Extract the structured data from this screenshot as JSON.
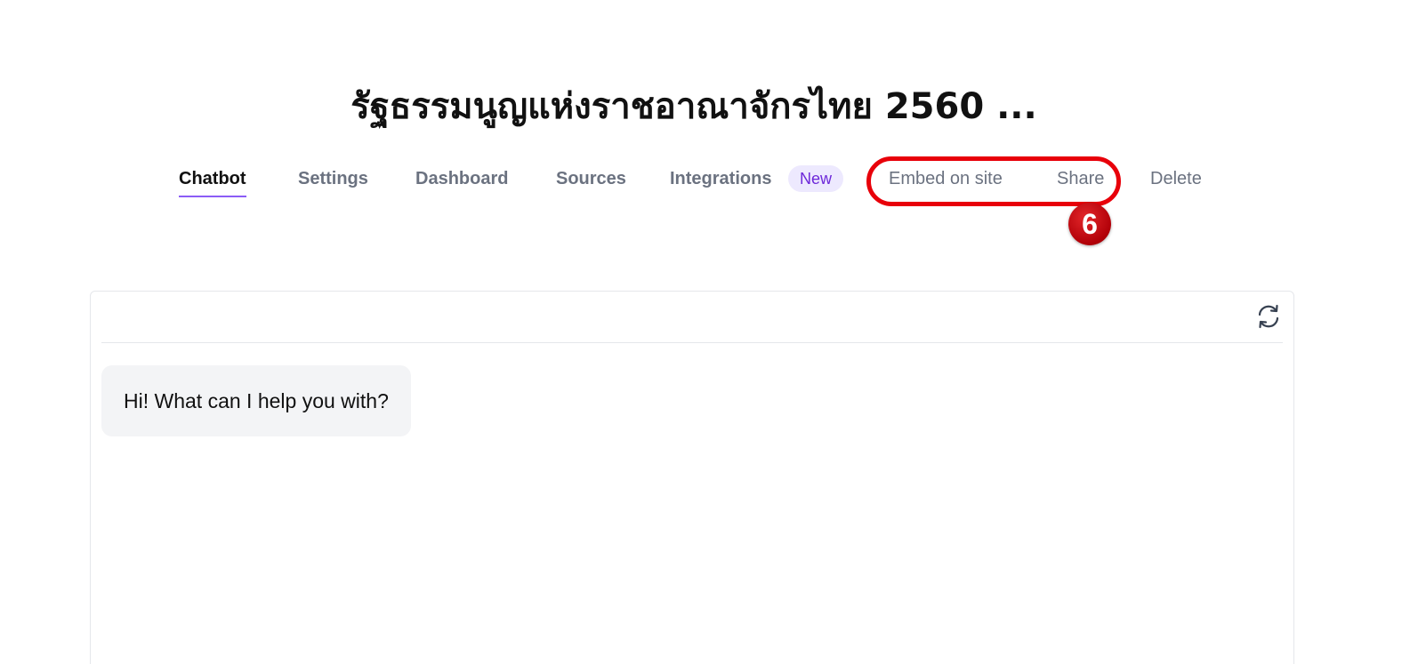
{
  "page_title": "รัฐธรรมนูญแห่งราชอาณาจักรไทย 2560 ...",
  "tabs": {
    "chatbot": "Chatbot",
    "settings": "Settings",
    "dashboard": "Dashboard",
    "sources": "Sources",
    "integrations": "Integrations",
    "integrations_badge": "New",
    "embed": "Embed on site",
    "share": "Share",
    "delete": "Delete"
  },
  "annotation": {
    "step_number": "6",
    "color": "#e8000a"
  },
  "chat": {
    "greeting": "Hi! What can I help you with?",
    "refresh_icon": "refresh-icon"
  },
  "colors": {
    "accent": "#8b5cf6",
    "badge_bg": "#ede9fe",
    "badge_text": "#6d28d9"
  }
}
